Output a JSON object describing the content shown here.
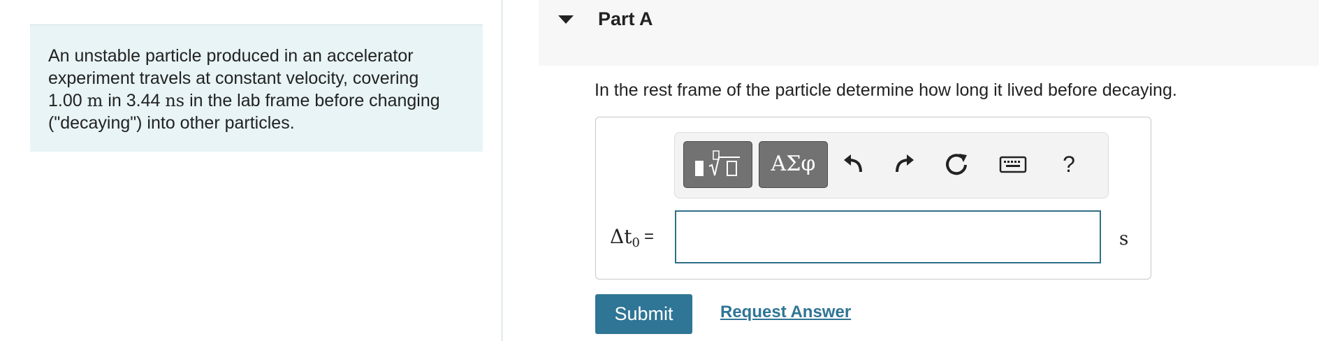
{
  "problem": {
    "line1": "An unstable particle produced in an accelerator",
    "line2": "experiment travels at constant velocity, covering",
    "distance_value": "1.00",
    "distance_unit": "m",
    "line3_mid": " in 3.44 ",
    "time_unit": "ns",
    "line3_end": " in the lab frame before changing",
    "line4": "(\"decaying\") into other particles."
  },
  "part": {
    "title": "Part A",
    "caret_icon": "caret-down-icon"
  },
  "question": "In the rest frame of the particle determine how long it lived before decaying.",
  "toolbar": {
    "templates_icon": "templates-icon",
    "symbols_label": "ΑΣφ",
    "undo_icon": "undo-icon",
    "redo_icon": "redo-icon",
    "reset_icon": "reset-icon",
    "keyboard_icon": "keyboard-icon",
    "help_label": "?"
  },
  "answer": {
    "var_symbol": "Δt",
    "var_subscript": "0",
    "equals": "=",
    "value": "",
    "unit": "s"
  },
  "buttons": {
    "submit": "Submit",
    "request": "Request Answer"
  },
  "colors": {
    "accent": "#2f7595",
    "problem_bg": "#e8f4f6",
    "header_bg": "#f7f7f7"
  }
}
